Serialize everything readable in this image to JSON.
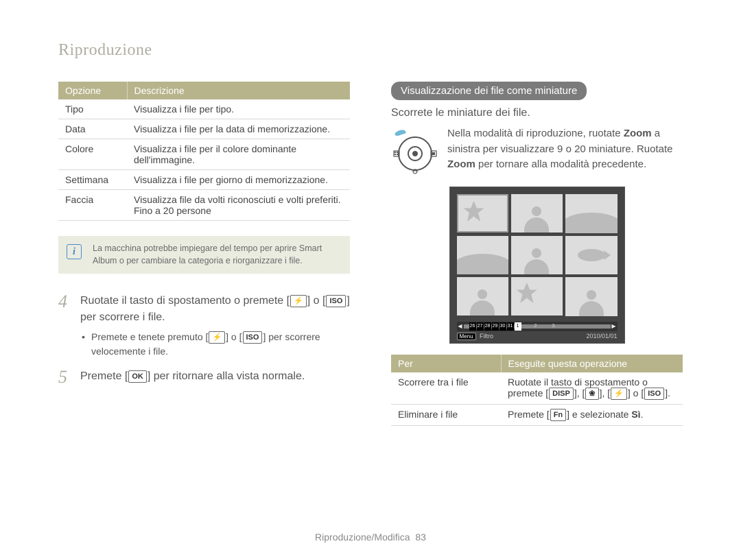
{
  "section_title": "Riproduzione",
  "options_table": {
    "head": {
      "opt": "Opzione",
      "desc": "Descrizione"
    },
    "rows": [
      {
        "opt": "Tipo",
        "desc": "Visualizza i file per tipo."
      },
      {
        "opt": "Data",
        "desc": "Visualizza i file per la data di memorizzazione."
      },
      {
        "opt": "Colore",
        "desc": "Visualizza i file per il colore dominante dell'immagine."
      },
      {
        "opt": "Settimana",
        "desc": "Visualizza i file per giorno di memorizzazione."
      },
      {
        "opt": "Faccia",
        "desc": "Visualizza file da volti riconosciuti e volti preferiti. Fino a 20 persone"
      }
    ]
  },
  "note": "La macchina potrebbe impiegare del tempo per aprire Smart Album o per cambiare la categoria e riorganizzare i file.",
  "steps": {
    "s4": {
      "num": "4",
      "pre": "Ruotate il tasto di spostamento o premete [",
      "mid": "] o [",
      "post": "] per scorrere i file.",
      "sub_pre": "Premete e tenete premuto [",
      "sub_mid": "] o [",
      "sub_post": "] per scorrere velocemente i file."
    },
    "s5": {
      "num": "5",
      "pre": "Premete [",
      "post": "] per ritornare alla vista normale."
    }
  },
  "keys": {
    "flash": "⚡",
    "iso": "ISO",
    "ok": "OK",
    "disp": "DISP",
    "macro": "❀",
    "fn": "Fn"
  },
  "right": {
    "pill": "Visualizzazione dei file come miniature",
    "intro": "Scorrete le miniature dei file.",
    "zoom_text": {
      "p1": "Nella modalità di riproduzione, ruotate ",
      "b1": "Zoom",
      "p2": " a sinistra per visualizzare 9 o 20 miniature. Ruotate ",
      "b2": "Zoom",
      "p3": " per tornare alla modalità precedente."
    },
    "screen": {
      "ticks": [
        "26",
        "27",
        "28",
        "29",
        "30",
        "31",
        "1",
        "2",
        "3"
      ],
      "menu": "Menu",
      "filter": "Filtro",
      "date": "2010/01/01"
    },
    "actions": {
      "head": {
        "per": "Per",
        "do": "Eseguite questa operazione"
      },
      "rows": {
        "r1": {
          "per": "Scorrere tra i file",
          "pre": "Ruotate il tasto di spostamento o premete [",
          "mid1": "], [",
          "mid2": "], [",
          "mid3": "] o [",
          "post": "]."
        },
        "r2": {
          "per": "Eliminare i file",
          "pre": "Premete [",
          "mid": "] e selezionate ",
          "si": "Sì",
          "post": "."
        }
      }
    }
  },
  "footer": {
    "label": "Riproduzione/Modifica",
    "page": "83"
  }
}
